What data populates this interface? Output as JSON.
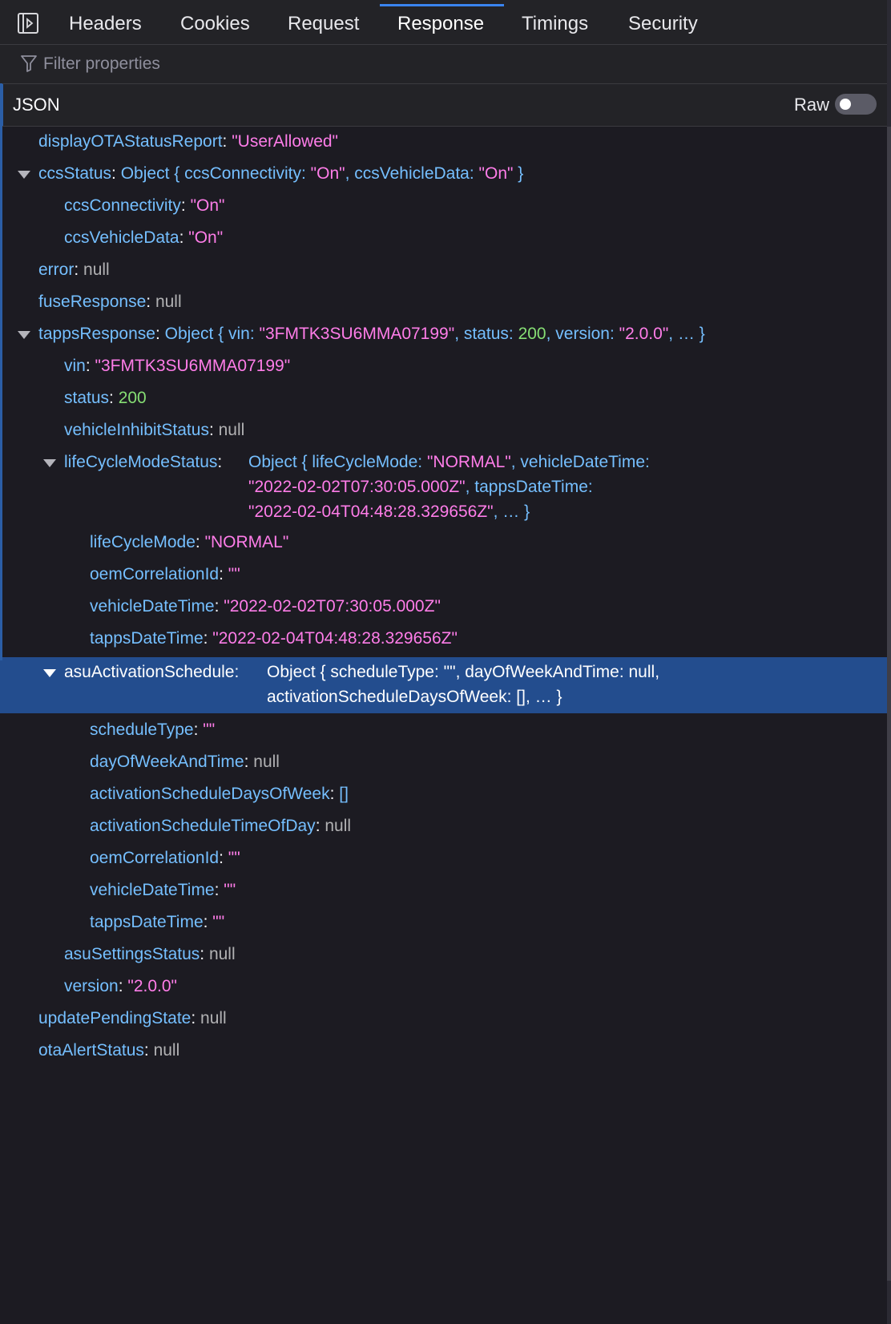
{
  "tabs": [
    {
      "label": "Headers"
    },
    {
      "label": "Cookies"
    },
    {
      "label": "Request"
    },
    {
      "label": "Response",
      "selected": true
    },
    {
      "label": "Timings"
    },
    {
      "label": "Security"
    }
  ],
  "filter": {
    "placeholder": "Filter properties"
  },
  "json_header": {
    "title": "JSON",
    "raw_label": "Raw",
    "raw_enabled": false
  },
  "colors": {
    "key": "#75bfff",
    "string": "#ff7de9",
    "number": "#86de74",
    "null": "#b1b1b3",
    "selected_row": "#234d8e",
    "accent": "#3a84f0"
  },
  "tree": {
    "displayOTAStatusReport": {
      "key": "displayOTAStatusReport",
      "value": "\"UserAllowed\""
    },
    "ccsStatus": {
      "key": "ccsStatus",
      "summary_prefix": "Object { ",
      "p1_key": "ccsConnectivity: ",
      "p1_val": "\"On\"",
      "sep": ", ",
      "p2_key": "ccsVehicleData: ",
      "p2_val": "\"On\"",
      "summary_suffix": " }",
      "ccsConnectivity": {
        "key": "ccsConnectivity",
        "value": "\"On\""
      },
      "ccsVehicleData": {
        "key": "ccsVehicleData",
        "value": "\"On\""
      }
    },
    "error": {
      "key": "error",
      "value": "null"
    },
    "fuseResponse": {
      "key": "fuseResponse",
      "value": "null"
    },
    "tappsResponse": {
      "key": "tappsResponse",
      "summary_prefix": "Object { ",
      "p1_key": "vin: ",
      "p1_val": "\"3FMTK3SU6MMA07199\"",
      "sep": ", ",
      "p2_key": "status: ",
      "p2_val": "200",
      "p3_key": "version: ",
      "p3_val": "\"2.0.0\"",
      "summary_suffix": ", … }",
      "vin": {
        "key": "vin",
        "value": "\"3FMTK3SU6MMA07199\""
      },
      "status": {
        "key": "status",
        "value": "200"
      },
      "vehicleInhibitStatus": {
        "key": "vehicleInhibitStatus",
        "value": "null"
      },
      "lifeCycleModeStatus": {
        "key": "lifeCycleModeStatus",
        "summary_line1_prefix": "Object { ",
        "l1_key": "lifeCycleMode: ",
        "l1_val": "\"NORMAL\"",
        "l1_sep": ", ",
        "l1_key2": "vehicleDateTime:",
        "l2_val": "\"2022-02-02T07:30:05.000Z\"",
        "l2_sep": ", ",
        "l2_key": "tappsDateTime:",
        "l3_val": "\"2022-02-04T04:48:28.329656Z\"",
        "l3_suffix": ", … }",
        "lifeCycleMode": {
          "key": "lifeCycleMode",
          "value": "\"NORMAL\""
        },
        "oemCorrelationId": {
          "key": "oemCorrelationId",
          "value": "\"\""
        },
        "vehicleDateTime": {
          "key": "vehicleDateTime",
          "value": "\"2022-02-02T07:30:05.000Z\""
        },
        "tappsDateTime": {
          "key": "tappsDateTime",
          "value": "\"2022-02-04T04:48:28.329656Z\""
        }
      },
      "asuActivationSchedule": {
        "key": "asuActivationSchedule",
        "l1_prefix": "Object { ",
        "l1_key": "scheduleType: ",
        "l1_val": "\"\"",
        "l1_sep": ", ",
        "l1_key2": "dayOfWeekAndTime: ",
        "l1_val2": "null",
        "l1_end": ",",
        "l2_key": "activationScheduleDaysOfWeek: ",
        "l2_val": "[]",
        "l2_suffix": ", … }",
        "scheduleType": {
          "key": "scheduleType",
          "value": "\"\""
        },
        "dayOfWeekAndTime": {
          "key": "dayOfWeekAndTime",
          "value": "null"
        },
        "activationScheduleDaysOfWeek": {
          "key": "activationScheduleDaysOfWeek",
          "value": "[]"
        },
        "activationScheduleTimeOfDay": {
          "key": "activationScheduleTimeOfDay",
          "value": "null"
        },
        "oemCorrelationId": {
          "key": "oemCorrelationId",
          "value": "\"\""
        },
        "vehicleDateTime": {
          "key": "vehicleDateTime",
          "value": "\"\""
        },
        "tappsDateTime": {
          "key": "tappsDateTime",
          "value": "\"\""
        }
      },
      "asuSettingsStatus": {
        "key": "asuSettingsStatus",
        "value": "null"
      },
      "version": {
        "key": "version",
        "value": "\"2.0.0\""
      }
    },
    "updatePendingState": {
      "key": "updatePendingState",
      "value": "null"
    },
    "otaAlertStatus": {
      "key": "otaAlertStatus",
      "value": "null"
    }
  },
  "separator": ": "
}
